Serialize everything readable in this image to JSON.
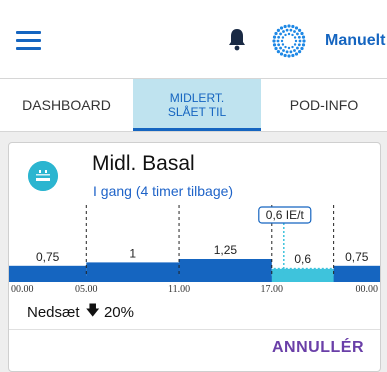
{
  "header": {
    "menu_icon": "hamburger-menu-icon",
    "notification_icon": "bell-icon",
    "mode_icon": "dotted-ring-icon",
    "mode_label": "Manuelt",
    "accent_color": "#1565c0"
  },
  "tabs": [
    {
      "label": "DASHBOARD",
      "active": false
    },
    {
      "label": "MIDLERT. SLÅET TIL",
      "active": true
    },
    {
      "label": "POD-INFO",
      "active": false
    }
  ],
  "card": {
    "icon": "temp-basal-icon",
    "title": "Midl. Basal",
    "status": "I gang (4 timer tilbage)",
    "current_rate_label": "0,6 IE/t",
    "reduce_label": "Nedsæt",
    "reduce_value": "20%",
    "cancel_label": "ANNULLÉR"
  },
  "chart_data": {
    "type": "bar",
    "x_ticks": [
      "00.00",
      "05.00",
      "11.00",
      "17.00",
      "00.00"
    ],
    "segments": [
      {
        "start_hour": 0,
        "end_hour": 5,
        "rate": 0.75,
        "label": "0,75",
        "kind": "basal"
      },
      {
        "start_hour": 5,
        "end_hour": 11,
        "rate": 1.0,
        "label": "1",
        "kind": "basal"
      },
      {
        "start_hour": 11,
        "end_hour": 17,
        "rate": 1.25,
        "label": "1,25",
        "kind": "basal"
      },
      {
        "start_hour": 17,
        "end_hour": 21,
        "rate": 0.6,
        "label": "0,6",
        "kind": "temp"
      },
      {
        "start_hour": 21,
        "end_hour": 24,
        "rate": 0.75,
        "label": "0,75",
        "kind": "basal"
      }
    ],
    "now_hour": 17,
    "colors": {
      "basal": "#1565c0",
      "temp": "#3ec3dc"
    }
  }
}
